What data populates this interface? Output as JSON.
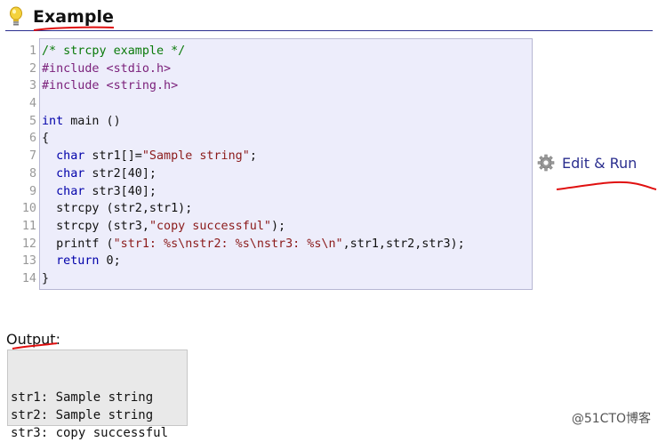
{
  "header": {
    "title": "Example",
    "icon": "lightbulb-icon"
  },
  "code": {
    "line_numbers": [
      "1",
      "2",
      "3",
      "4",
      "5",
      "6",
      "7",
      "8",
      "9",
      "10",
      "11",
      "12",
      "13",
      "14"
    ],
    "lines": [
      [
        {
          "t": "/* strcpy example */",
          "k": "comment"
        }
      ],
      [
        {
          "t": "#include <stdio.h>",
          "k": "preproc"
        }
      ],
      [
        {
          "t": "#include <string.h>",
          "k": "preproc"
        }
      ],
      [],
      [
        {
          "t": "int",
          "k": "keyword"
        },
        {
          "t": " main ()",
          "k": "plain"
        }
      ],
      [
        {
          "t": "{",
          "k": "plain"
        }
      ],
      [
        {
          "t": "  ",
          "k": "plain"
        },
        {
          "t": "char",
          "k": "keyword"
        },
        {
          "t": " str1[]=",
          "k": "plain"
        },
        {
          "t": "\"Sample string\"",
          "k": "string"
        },
        {
          "t": ";",
          "k": "plain"
        }
      ],
      [
        {
          "t": "  ",
          "k": "plain"
        },
        {
          "t": "char",
          "k": "keyword"
        },
        {
          "t": " str2[40];",
          "k": "plain"
        }
      ],
      [
        {
          "t": "  ",
          "k": "plain"
        },
        {
          "t": "char",
          "k": "keyword"
        },
        {
          "t": " str3[40];",
          "k": "plain"
        }
      ],
      [
        {
          "t": "  strcpy (str2,str1);",
          "k": "plain"
        }
      ],
      [
        {
          "t": "  strcpy (str3,",
          "k": "plain"
        },
        {
          "t": "\"copy successful\"",
          "k": "string"
        },
        {
          "t": ");",
          "k": "plain"
        }
      ],
      [
        {
          "t": "  printf (",
          "k": "plain"
        },
        {
          "t": "\"str1: %s\\nstr2: %s\\nstr3: %s\\n\"",
          "k": "string"
        },
        {
          "t": ",str1,str2,str3);",
          "k": "plain"
        }
      ],
      [
        {
          "t": "  ",
          "k": "plain"
        },
        {
          "t": "return",
          "k": "keyword"
        },
        {
          "t": " 0;",
          "k": "plain"
        }
      ],
      [
        {
          "t": "}",
          "k": "plain"
        }
      ]
    ]
  },
  "edit_run": {
    "label": "Edit & Run",
    "icon": "gear-icon"
  },
  "output": {
    "label": "Output:",
    "lines": [
      "",
      "str1: Sample string",
      "str2: Sample string",
      "str3: copy successful"
    ]
  },
  "watermark": "@51CTO博客",
  "colors": {
    "accent": "#2b2f8f",
    "code_bg": "#ededfb",
    "annotation_red": "#e01010"
  }
}
